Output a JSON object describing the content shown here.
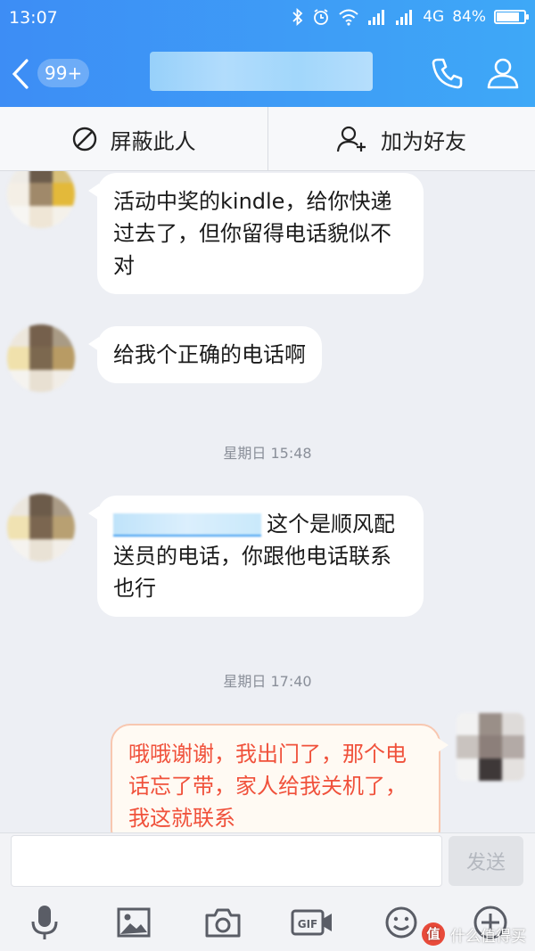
{
  "status_bar": {
    "time": "13:07",
    "network": "4G",
    "battery": "84%",
    "battery_level": 0.84
  },
  "nav": {
    "unread_badge": "99+",
    "accent_color": "#3d8df5"
  },
  "actions": {
    "block_label": "屏蔽此人",
    "add_friend_label": "加为好友"
  },
  "messages": [
    {
      "side": "left",
      "text": "活动中奖的kindle，给你快递过去了，但你留得电话貌似不对"
    },
    {
      "side": "left",
      "text": "给我个正确的电话啊"
    },
    {
      "type": "time",
      "text": "星期日 15:48"
    },
    {
      "side": "left",
      "text_after_link": "这个是顺风配送员的电话，你跟他电话联系也行"
    },
    {
      "type": "time",
      "text": "星期日 17:40"
    },
    {
      "side": "right",
      "text": "哦哦谢谢，我出门了，那个电话忘了带，家人给我关机了，我这就联系"
    }
  ],
  "input": {
    "value": "",
    "send_label": "发送"
  },
  "toolbar_icons": [
    "microphone-icon",
    "image-icon",
    "camera-icon",
    "gif-icon",
    "emoji-icon",
    "plus-icon"
  ],
  "watermark": {
    "badge": "值",
    "text": "什么值得买"
  },
  "colors": {
    "reply_text": "#f0513b",
    "link_underline": "#3c9bf0"
  }
}
